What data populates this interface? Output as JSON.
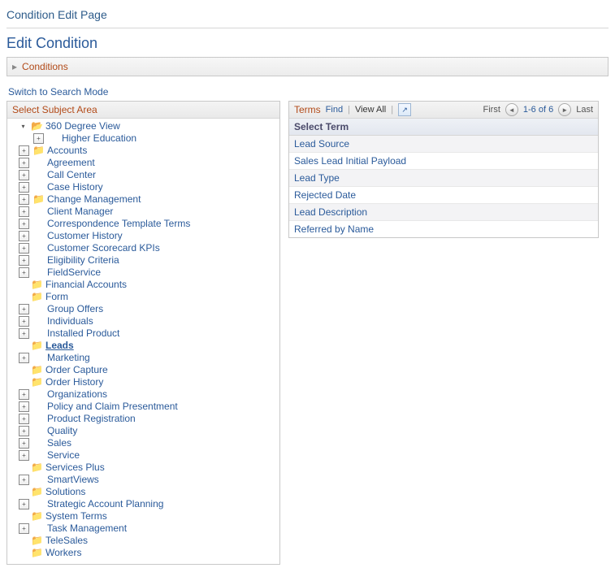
{
  "page": {
    "breadcrumb": "Condition Edit Page",
    "heading": "Edit Condition",
    "conditions_label": "Conditions",
    "switch_link": "Switch to Search Mode"
  },
  "subject": {
    "header": "Select Subject Area",
    "icons": {
      "folder_open": "📂",
      "folder_closed": "📁"
    },
    "expanded_root": {
      "label": "360 Degree View",
      "child": "Higher Education"
    },
    "selected": "Leads",
    "items": [
      {
        "label": "Accounts",
        "icon": "closed",
        "exp": "plus"
      },
      {
        "label": "Agreement",
        "icon": "none",
        "exp": "plus"
      },
      {
        "label": "Call Center",
        "icon": "none",
        "exp": "plus"
      },
      {
        "label": "Case History",
        "icon": "none",
        "exp": "plus"
      },
      {
        "label": "Change Management",
        "icon": "closed",
        "exp": "plus"
      },
      {
        "label": "Client Manager",
        "icon": "none",
        "exp": "plus"
      },
      {
        "label": "Correspondence Template Terms",
        "icon": "none",
        "exp": "plus"
      },
      {
        "label": "Customer History",
        "icon": "none",
        "exp": "plus"
      },
      {
        "label": "Customer Scorecard KPIs",
        "icon": "none",
        "exp": "plus"
      },
      {
        "label": "Eligibility Criteria",
        "icon": "none",
        "exp": "plus"
      },
      {
        "label": "FieldService",
        "icon": "none",
        "exp": "plus"
      },
      {
        "label": "Financial Accounts",
        "icon": "closed",
        "exp": "none"
      },
      {
        "label": "Form",
        "icon": "closed",
        "exp": "none"
      },
      {
        "label": "Group Offers",
        "icon": "none",
        "exp": "plus"
      },
      {
        "label": "Individuals",
        "icon": "none",
        "exp": "plus"
      },
      {
        "label": "Installed Product",
        "icon": "none",
        "exp": "plus"
      },
      {
        "label": "Leads",
        "icon": "closed",
        "exp": "none"
      },
      {
        "label": "Marketing",
        "icon": "none",
        "exp": "plus"
      },
      {
        "label": "Order Capture",
        "icon": "closed",
        "exp": "none"
      },
      {
        "label": "Order History",
        "icon": "closed",
        "exp": "none"
      },
      {
        "label": "Organizations",
        "icon": "none",
        "exp": "plus"
      },
      {
        "label": "Policy and Claim Presentment",
        "icon": "none",
        "exp": "plus"
      },
      {
        "label": "Product Registration",
        "icon": "none",
        "exp": "plus"
      },
      {
        "label": "Quality",
        "icon": "none",
        "exp": "plus"
      },
      {
        "label": "Sales",
        "icon": "none",
        "exp": "plus"
      },
      {
        "label": "Service",
        "icon": "none",
        "exp": "plus"
      },
      {
        "label": "Services Plus",
        "icon": "closed",
        "exp": "none"
      },
      {
        "label": "SmartViews",
        "icon": "none",
        "exp": "plus"
      },
      {
        "label": "Solutions",
        "icon": "closed",
        "exp": "none"
      },
      {
        "label": "Strategic Account Planning",
        "icon": "none",
        "exp": "plus"
      },
      {
        "label": "System Terms",
        "icon": "closed",
        "exp": "none"
      },
      {
        "label": "Task Management",
        "icon": "none",
        "exp": "plus"
      },
      {
        "label": "TeleSales",
        "icon": "closed",
        "exp": "none"
      },
      {
        "label": "Workers",
        "icon": "closed",
        "exp": "none"
      }
    ]
  },
  "terms": {
    "title": "Terms",
    "find": "Find",
    "view_all": "View All",
    "first": "First",
    "last": "Last",
    "range": "1-6 of 6",
    "subheader": "Select Term",
    "rows": [
      "Lead Source",
      "Sales Lead Initial Payload",
      "Lead Type",
      "Rejected Date",
      "Lead Description",
      "Referred by Name"
    ]
  }
}
